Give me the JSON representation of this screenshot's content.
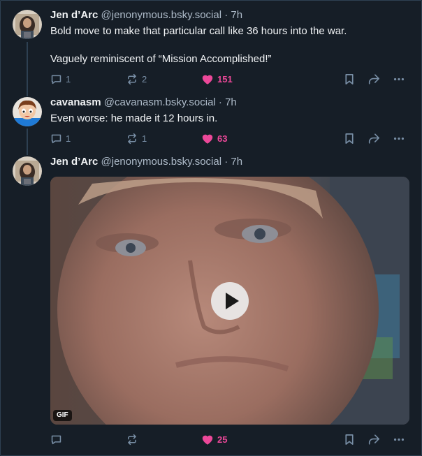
{
  "posts": [
    {
      "author": "Jen d’Arc",
      "handle": "@jenonymous.bsky.social",
      "separator": "·",
      "time": "7h",
      "text_line1": "Bold move to make that particular call like 36 hours into the war.",
      "text_line2": "Vaguely reminiscent of “Mission Accomplished!”",
      "replies": "1",
      "reposts": "2",
      "likes": "151",
      "avatar_icon": "avatar-woman-dark-hair"
    },
    {
      "author": "cavanasm",
      "handle": "@cavanasm.bsky.social",
      "separator": "·",
      "time": "7h",
      "text_line1": "Even worse: he made it 12 hours in.",
      "replies": "1",
      "reposts": "1",
      "likes": "63",
      "avatar_icon": "avatar-cartoon-character"
    },
    {
      "author": "Jen d’Arc",
      "handle": "@jenonymous.bsky.social",
      "separator": "·",
      "time": "7h",
      "media": {
        "badge": "GIF",
        "icon": "play-icon"
      },
      "replies": "",
      "reposts": "",
      "likes": "25",
      "avatar_icon": "avatar-woman-dark-hair"
    }
  ],
  "colors": {
    "background": "#161e27",
    "text": "#f1f3f5",
    "muted": "#aebbc9",
    "icon": "#788ea5",
    "like": "#ec4899",
    "thread_line": "#2e4052"
  }
}
